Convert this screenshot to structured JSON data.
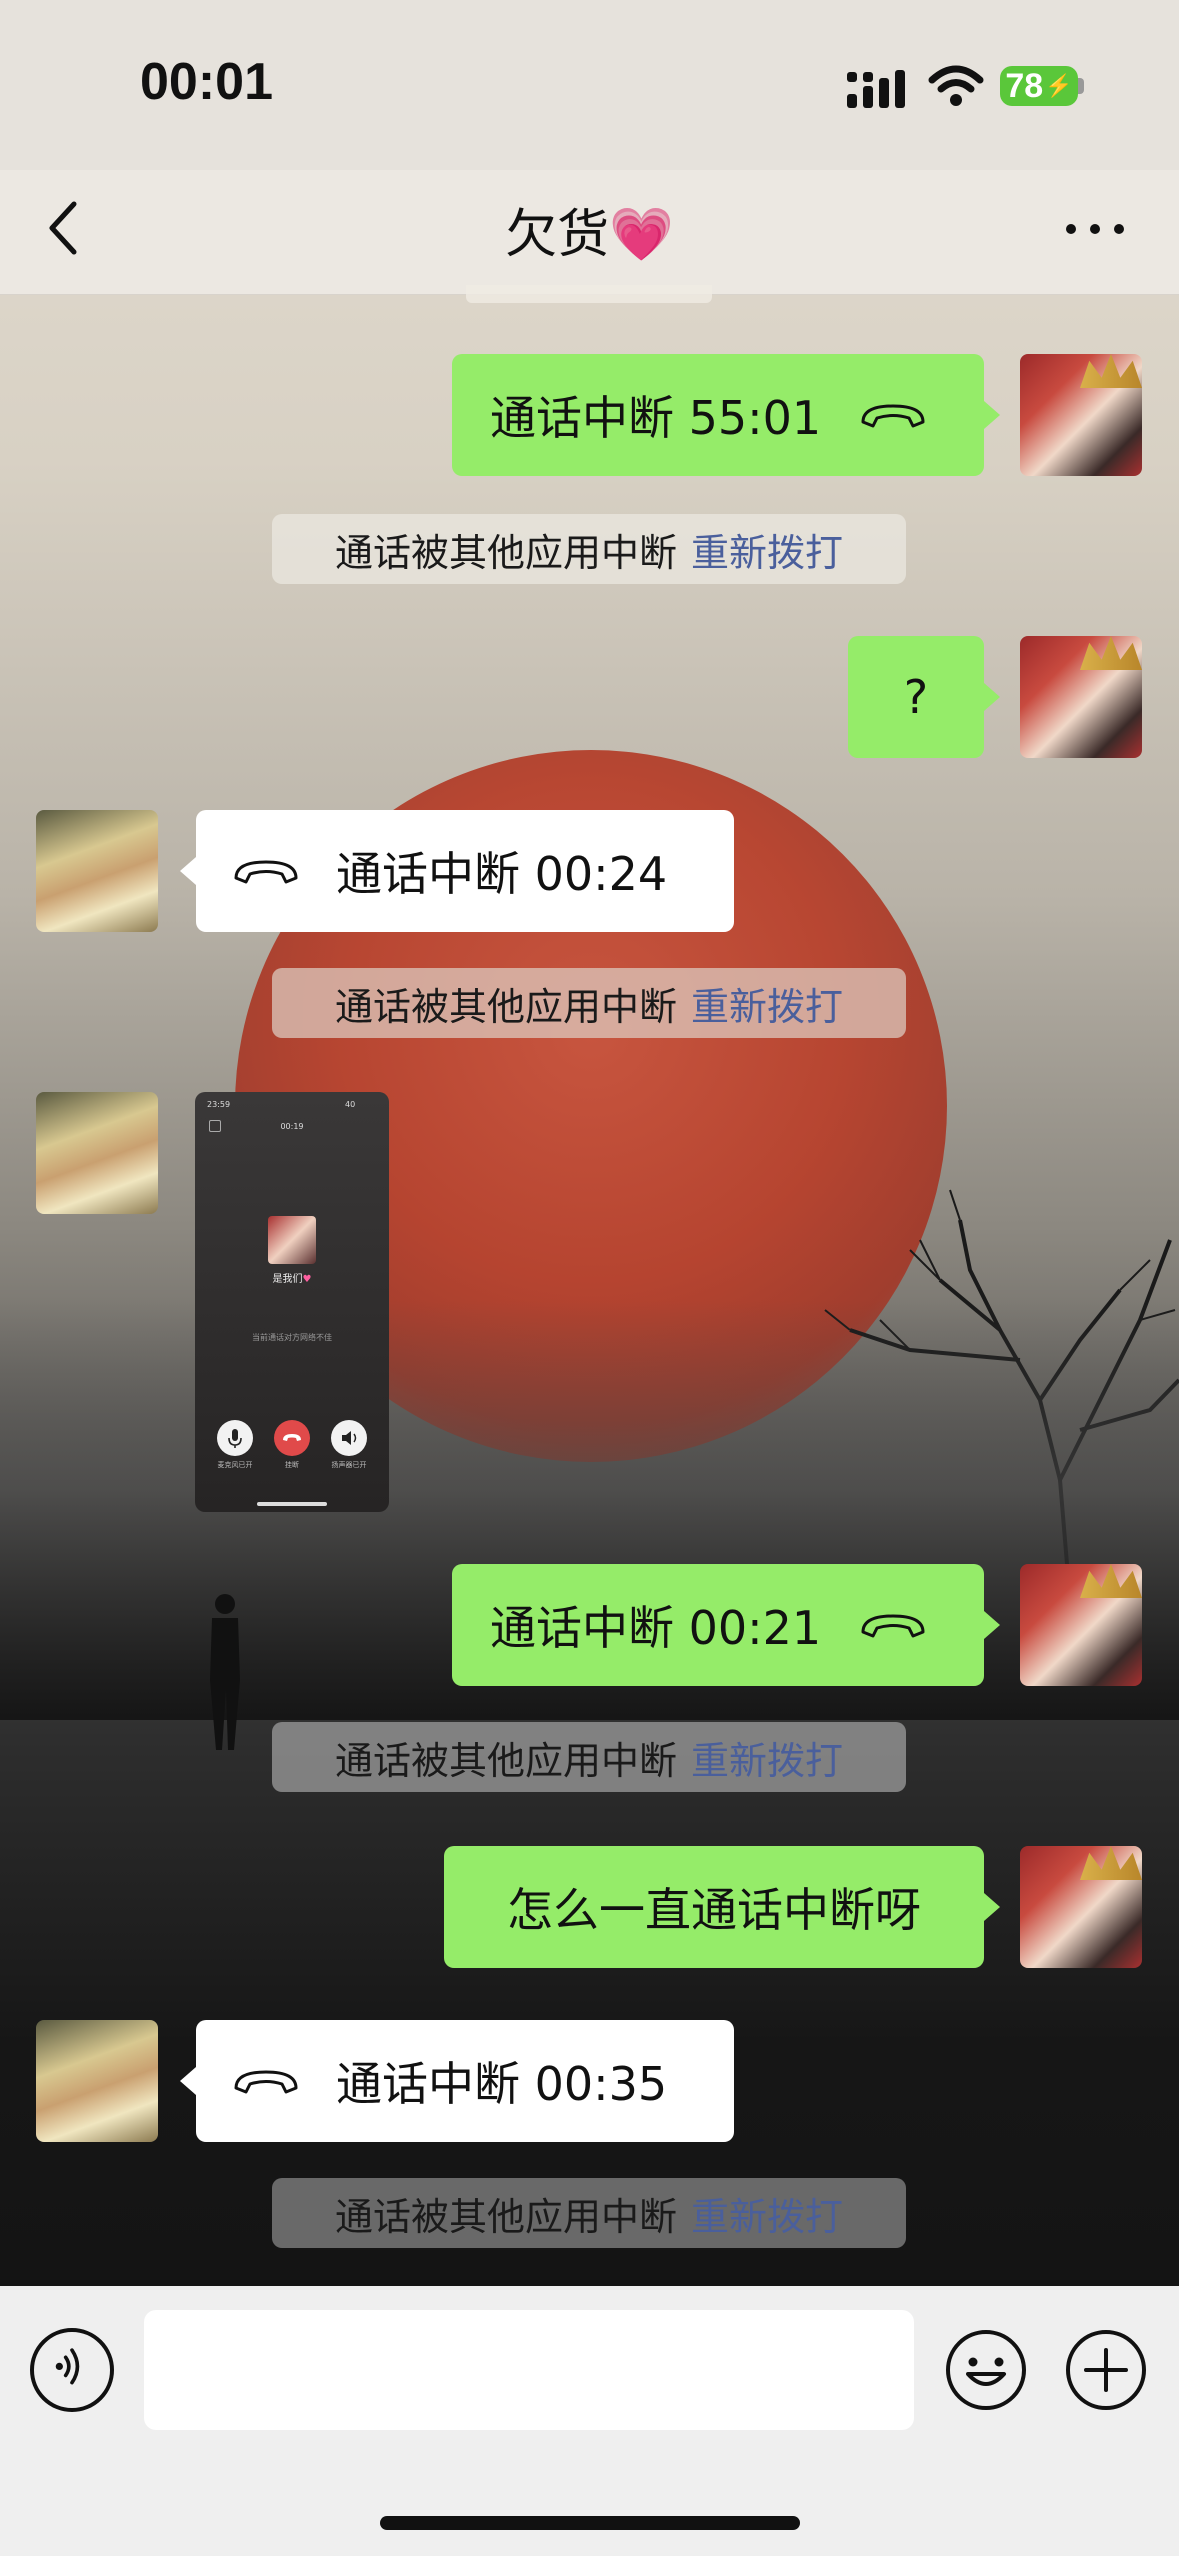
{
  "status_bar": {
    "time": "00:01",
    "battery": "78"
  },
  "nav": {
    "title": "欠货💗"
  },
  "messages": [
    {
      "side": "right",
      "type": "call",
      "text": "通话中断 55:01"
    },
    {
      "type": "notice",
      "text": "通话被其他应用中断",
      "link": "重新拨打"
    },
    {
      "side": "right",
      "type": "text",
      "text": "?"
    },
    {
      "side": "left",
      "type": "call",
      "text": "通话中断 00:24"
    },
    {
      "type": "notice",
      "text": "通话被其他应用中断",
      "link": "重新拨打"
    },
    {
      "side": "left",
      "type": "image",
      "screenshot": {
        "time": "23:59",
        "battery": "40",
        "duration": "00:19",
        "name": "是我们",
        "note": "当前通话对方网络不佳",
        "buttons": [
          "麦克风已开",
          "挂断",
          "扬声器已开"
        ]
      }
    },
    {
      "side": "right",
      "type": "call",
      "text": "通话中断 00:21"
    },
    {
      "type": "notice",
      "text": "通话被其他应用中断",
      "link": "重新拨打"
    },
    {
      "side": "right",
      "type": "text",
      "text": "怎么一直通话中断呀"
    },
    {
      "side": "left",
      "type": "call",
      "text": "通话中断 00:35"
    },
    {
      "type": "notice",
      "text": "通话被其他应用中断",
      "link": "重新拨打"
    }
  ],
  "input": {
    "value": "",
    "placeholder": ""
  },
  "colors": {
    "my_bubble": "#95ec69",
    "their_bubble": "#ffffff",
    "link": "#4a5f9c",
    "end_call": "#e04a4a"
  }
}
